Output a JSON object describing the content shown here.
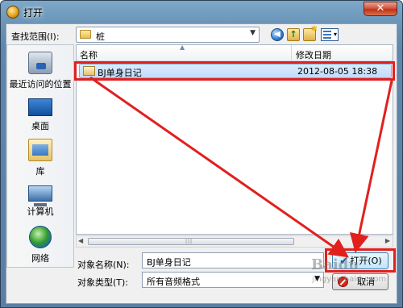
{
  "window": {
    "title": "打开",
    "close_symbol": "✕"
  },
  "toolbar": {
    "lookin_label": "查找范围(I):",
    "lookin_value": "桩",
    "back_icon": "back-icon",
    "up_icon": "up-folder-icon",
    "new_folder_icon": "new-folder-icon",
    "view_icon": "view-menu-icon"
  },
  "places": [
    {
      "label": "最近访问的位置",
      "icon": "recent-places-icon"
    },
    {
      "label": "桌面",
      "icon": "desktop-icon"
    },
    {
      "label": "库",
      "icon": "libraries-icon"
    },
    {
      "label": "计算机",
      "icon": "computer-icon"
    },
    {
      "label": "网络",
      "icon": "network-icon"
    }
  ],
  "filelist": {
    "columns": {
      "name": "名称",
      "date": "修改日期"
    },
    "rows": [
      {
        "name": "BJ单身日记",
        "date": "2012-08-05 18:38"
      }
    ]
  },
  "form": {
    "name_label": "对象名称(N):",
    "name_value": "BJ单身日记",
    "type_label": "对象类型(T):",
    "type_value": "所有音频格式"
  },
  "buttons": {
    "open": "打开(O)",
    "cancel": "取消"
  },
  "watermark": {
    "brand": "Baidu",
    "url": "jingyan.baidu.com"
  },
  "colors": {
    "highlight": "#e1201e",
    "selection": "#c1dcfc",
    "title_gradient": "#6a93b6"
  }
}
